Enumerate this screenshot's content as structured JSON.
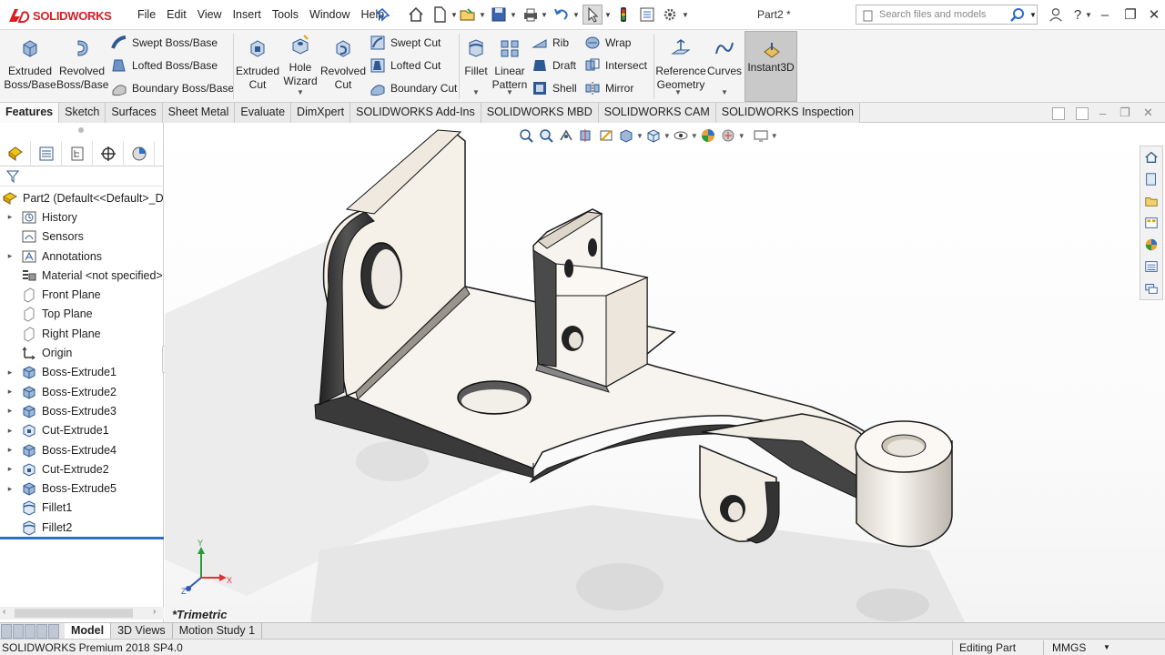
{
  "app": {
    "brand": "SOLIDWORKS",
    "document_title": "Part2 *",
    "menu": [
      "File",
      "Edit",
      "View",
      "Insert",
      "Tools",
      "Window",
      "Help"
    ],
    "search_placeholder": "Search files and models"
  },
  "command_manager": {
    "extruded_boss": "Extruded\nBoss/Base",
    "revolved_boss": "Revolved\nBoss/Base",
    "swept_boss": "Swept Boss/Base",
    "lofted_boss": "Lofted Boss/Base",
    "boundary_boss": "Boundary Boss/Base",
    "extruded_cut": "Extruded\nCut",
    "hole_wizard": "Hole\nWizard",
    "revolved_cut": "Revolved\nCut",
    "swept_cut": "Swept Cut",
    "lofted_cut": "Lofted Cut",
    "boundary_cut": "Boundary Cut",
    "fillet": "Fillet",
    "linear_pattern": "Linear\nPattern",
    "rib": "Rib",
    "draft": "Draft",
    "shell": "Shell",
    "wrap": "Wrap",
    "intersect": "Intersect",
    "mirror": "Mirror",
    "reference_geometry": "Reference\nGeometry",
    "curves": "Curves",
    "instant3d": "Instant3D"
  },
  "tabs": [
    "Features",
    "Sketch",
    "Surfaces",
    "Sheet Metal",
    "Evaluate",
    "DimXpert",
    "SOLIDWORKS Add-Ins",
    "SOLIDWORKS MBD",
    "SOLIDWORKS CAM",
    "SOLIDWORKS Inspection"
  ],
  "feature_tree": {
    "root": "Part2  (Default<<Default>_Di",
    "items": [
      {
        "label": "History",
        "icon": "history-icon",
        "expandable": true
      },
      {
        "label": "Sensors",
        "icon": "sensor-icon",
        "expandable": false
      },
      {
        "label": "Annotations",
        "icon": "annotation-icon",
        "expandable": true
      },
      {
        "label": "Material <not specified>",
        "icon": "material-icon",
        "expandable": false
      },
      {
        "label": "Front Plane",
        "icon": "plane-icon",
        "expandable": false
      },
      {
        "label": "Top Plane",
        "icon": "plane-icon",
        "expandable": false
      },
      {
        "label": "Right Plane",
        "icon": "plane-icon",
        "expandable": false
      },
      {
        "label": "Origin",
        "icon": "origin-icon",
        "expandable": false
      },
      {
        "label": "Boss-Extrude1",
        "icon": "boss-extrude-icon",
        "expandable": true
      },
      {
        "label": "Boss-Extrude2",
        "icon": "boss-extrude-icon",
        "expandable": true
      },
      {
        "label": "Boss-Extrude3",
        "icon": "boss-extrude-icon",
        "expandable": true
      },
      {
        "label": "Cut-Extrude1",
        "icon": "cut-extrude-icon",
        "expandable": true
      },
      {
        "label": "Boss-Extrude4",
        "icon": "boss-extrude-icon",
        "expandable": true
      },
      {
        "label": "Cut-Extrude2",
        "icon": "cut-extrude-icon",
        "expandable": true
      },
      {
        "label": "Boss-Extrude5",
        "icon": "boss-extrude-icon",
        "expandable": true
      },
      {
        "label": "Fillet1",
        "icon": "fillet-icon",
        "expandable": false
      },
      {
        "label": "Fillet2",
        "icon": "fillet-icon",
        "expandable": false
      }
    ]
  },
  "viewport": {
    "view_label": "*Trimetric"
  },
  "bottom_tabs": [
    "Model",
    "3D Views",
    "Motion Study 1"
  ],
  "status_bar": {
    "product": "SOLIDWORKS Premium 2018 SP4.0",
    "mode": "Editing Part",
    "units": "MMGS"
  },
  "colors": {
    "brand_red": "#d71e26",
    "selection_blue": "#2d73c4",
    "part_face": "#f7f3ee",
    "part_edge": "#1a1a1a"
  }
}
